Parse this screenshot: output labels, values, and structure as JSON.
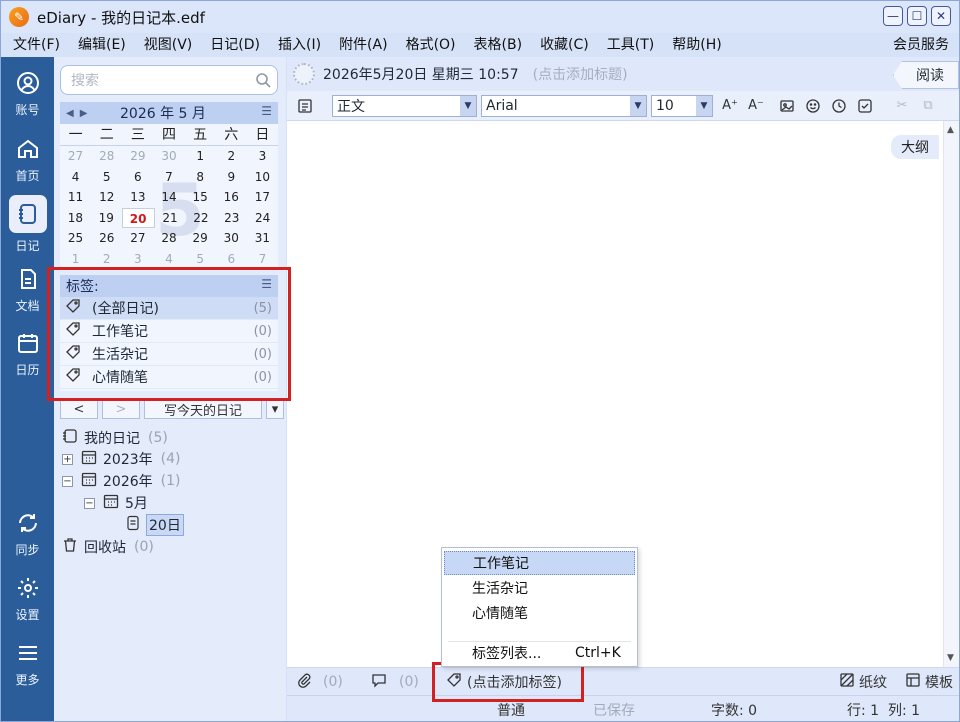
{
  "app": {
    "title": "eDiary - 我的日记本.edf",
    "logo": "app-logo-icon"
  },
  "menu": {
    "items": [
      "文件(F)",
      "编辑(E)",
      "视图(V)",
      "日记(D)",
      "插入(I)",
      "附件(A)",
      "格式(O)",
      "表格(B)",
      "收藏(C)",
      "工具(T)",
      "帮助(H)"
    ],
    "member": "会员服务"
  },
  "nav": {
    "items": [
      {
        "label": "账号",
        "icon": "account-icon"
      },
      {
        "label": "首页",
        "icon": "home-icon"
      },
      {
        "label": "日记",
        "icon": "diary-icon"
      },
      {
        "label": "文档",
        "icon": "document-icon"
      },
      {
        "label": "日历",
        "icon": "calendar-icon"
      },
      {
        "label": "同步",
        "icon": "sync-icon"
      },
      {
        "label": "设置",
        "icon": "settings-icon"
      },
      {
        "label": "更多",
        "icon": "menu-icon"
      }
    ],
    "active": "日记"
  },
  "search": {
    "placeholder": "搜索"
  },
  "calendar": {
    "month_label": "2026 年 5 月",
    "watermark": "5",
    "weekdays": [
      "一",
      "二",
      "三",
      "四",
      "五",
      "六",
      "日"
    ],
    "rows": [
      [
        "27",
        "28",
        "29",
        "30",
        "1",
        "2",
        "3"
      ],
      [
        "4",
        "5",
        "6",
        "7",
        "8",
        "9",
        "10"
      ],
      [
        "11",
        "12",
        "13",
        "14",
        "15",
        "16",
        "17"
      ],
      [
        "18",
        "19",
        "20",
        "21",
        "22",
        "23",
        "24"
      ],
      [
        "25",
        "26",
        "27",
        "28",
        "29",
        "30",
        "31"
      ],
      [
        "1",
        "2",
        "3",
        "4",
        "5",
        "6",
        "7"
      ]
    ],
    "today": "20"
  },
  "tags": {
    "header": "标签:",
    "items": [
      {
        "label": "(全部日记)",
        "count": "(5)"
      },
      {
        "label": "工作笔记",
        "count": "(0)"
      },
      {
        "label": "生活杂记",
        "count": "(0)"
      },
      {
        "label": "心情随笔",
        "count": "(0)"
      }
    ]
  },
  "diary_nav": {
    "prev": "<",
    "next": ">",
    "write_today": "写今天的日记",
    "dropdown": "▾"
  },
  "tree": {
    "root": {
      "label": "我的日记",
      "count": "(5)"
    },
    "y2023": {
      "label": "2023年",
      "count": "(4)"
    },
    "y2026": {
      "label": "2026年",
      "count": "(1)"
    },
    "may": {
      "label": "5月"
    },
    "day": {
      "label": "20日"
    },
    "trash": {
      "label": "回收站",
      "count": "(0)"
    }
  },
  "entry": {
    "date": "2026年5月20日 星期三 10:57",
    "title_placeholder": "(点击添加标题)",
    "read_tab": "阅读",
    "outline": "大纲"
  },
  "format": {
    "style": "正文",
    "font": "Arial",
    "size": "10"
  },
  "tag_popup": {
    "items": [
      "工作笔记",
      "生活杂记",
      "心情随笔"
    ],
    "tag_list": "标签列表...",
    "tag_list_shortcut": "Ctrl+K"
  },
  "bottom": {
    "attach_count": "(0)",
    "comment_count": "(0)",
    "add_tag": "(点击添加标签)",
    "paper": "纸纹",
    "template": "模板"
  },
  "status": {
    "mode": "普通",
    "saved": "已保存",
    "word_count": "字数: 0",
    "position": "行: 1  列: 1"
  }
}
